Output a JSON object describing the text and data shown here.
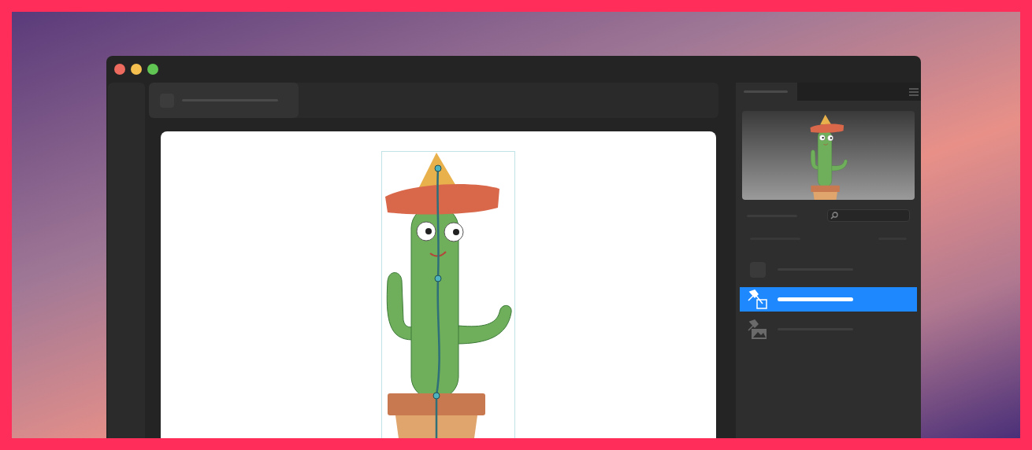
{
  "layers": [
    {
      "kind": "blank",
      "selected": false
    },
    {
      "kind": "pin",
      "selected": true
    },
    {
      "kind": "image",
      "selected": false
    }
  ]
}
